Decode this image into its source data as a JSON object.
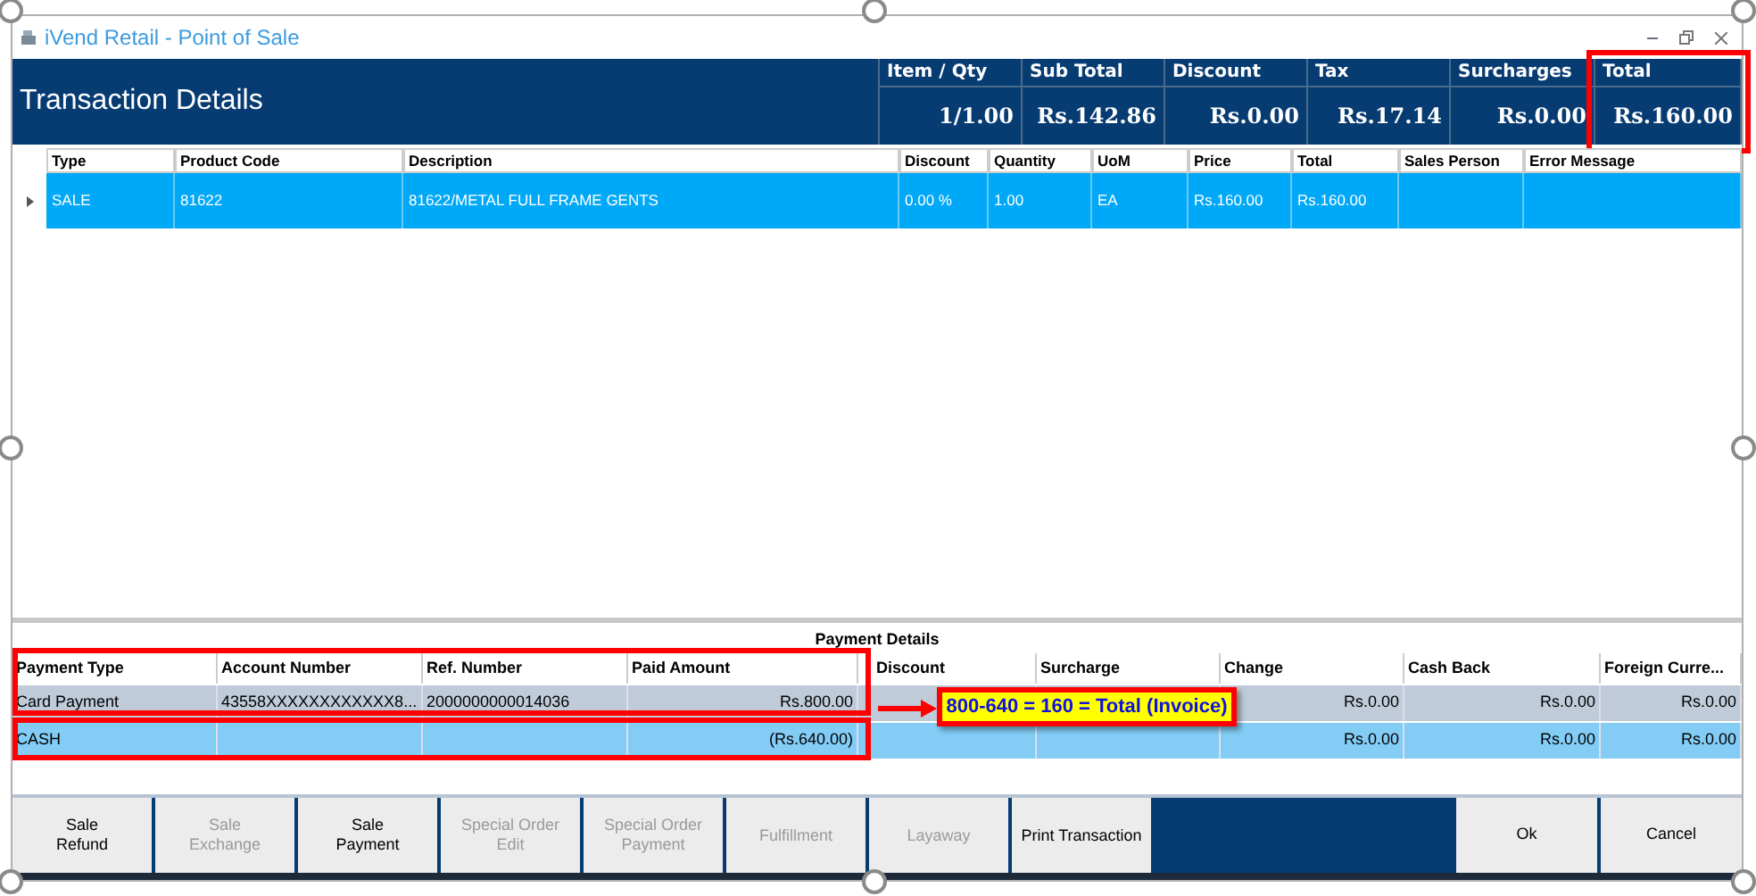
{
  "window": {
    "title": "iVend Retail - Point of Sale"
  },
  "header": {
    "title": "Transaction Details"
  },
  "summary": [
    {
      "label": "Item / Qty",
      "value": "1/1.00",
      "highlighted": false
    },
    {
      "label": "Sub Total",
      "value": "Rs.142.86",
      "highlighted": false
    },
    {
      "label": "Discount",
      "value": "Rs.0.00",
      "highlighted": false
    },
    {
      "label": "Tax",
      "value": "Rs.17.14",
      "highlighted": false
    },
    {
      "label": "Surcharges",
      "value": "Rs.0.00",
      "highlighted": false
    },
    {
      "label": "Total",
      "value": "Rs.160.00",
      "highlighted": true
    }
  ],
  "items_table": {
    "columns": [
      "Type",
      "Product Code",
      "Description",
      "Discount",
      "Quantity",
      "UoM",
      "Price",
      "Total",
      "Sales Person",
      "Error Message"
    ],
    "rows": [
      {
        "selected": true,
        "cells": [
          "SALE",
          "81622",
          "81622/METAL FULL FRAME GENTS",
          "0.00 %",
          "1.00",
          "EA",
          "Rs.160.00",
          "Rs.160.00",
          "",
          ""
        ]
      }
    ]
  },
  "payment_details": {
    "title": "Payment Details",
    "columns": [
      "Payment Type",
      "Account Number",
      "Ref. Number",
      "Paid Amount",
      "Discount",
      "Surcharge",
      "Change",
      "Cash Back",
      "Foreign Curre..."
    ],
    "rows": [
      {
        "selected": false,
        "highlighted": true,
        "cells": [
          "Card Payment",
          "43558XXXXXXXXXXXX8...",
          "2000000000014036",
          "Rs.800.00",
          "",
          "",
          "Rs.0.00",
          "Rs.0.00",
          "Rs.0.00"
        ]
      },
      {
        "selected": true,
        "highlighted": true,
        "cells": [
          "CASH",
          "",
          "",
          "(Rs.640.00)",
          "",
          "",
          "Rs.0.00",
          "Rs.0.00",
          "Rs.0.00"
        ]
      }
    ]
  },
  "callout": {
    "text": "800-640 = 160 = Total (Invoice)"
  },
  "buttons": [
    {
      "label": "Sale\nRefund",
      "disabled": false
    },
    {
      "label": "Sale\nExchange",
      "disabled": true
    },
    {
      "label": "Sale\nPayment",
      "disabled": false
    },
    {
      "label": "Special Order\nEdit",
      "disabled": true
    },
    {
      "label": "Special Order\nPayment",
      "disabled": true
    },
    {
      "label": "Fulfillment",
      "disabled": true
    },
    {
      "label": "Layaway",
      "disabled": true
    },
    {
      "label": "Print Transaction",
      "disabled": false
    }
  ],
  "dialog_buttons": [
    {
      "label": "Ok",
      "disabled": false
    },
    {
      "label": "Cancel",
      "disabled": false
    }
  ]
}
